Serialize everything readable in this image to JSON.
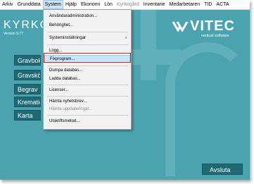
{
  "menubar": {
    "items": [
      {
        "label": "Arkiv",
        "state": "normal"
      },
      {
        "label": "Grunddata",
        "state": "normal"
      },
      {
        "label": "System",
        "state": "active"
      },
      {
        "label": "Hjälp",
        "state": "normal"
      },
      {
        "label": "Ekonomi",
        "state": "normal"
      },
      {
        "label": "Lön",
        "state": "normal"
      },
      {
        "label": "Kyrkogård",
        "state": "disabled"
      },
      {
        "label": "Inventarie",
        "state": "normal"
      },
      {
        "label": "Medarbetaren",
        "state": "normal"
      },
      {
        "label": "TID",
        "state": "normal"
      },
      {
        "label": "ACTA",
        "state": "normal"
      }
    ]
  },
  "app": {
    "title": "KYRKO",
    "version": "Version 9.77"
  },
  "logo": {
    "name": "VITEC",
    "tagline": "vertical software"
  },
  "nav_buttons": [
    {
      "label": "Gravbok"
    },
    {
      "label": "Gravsköt"
    },
    {
      "label": "Begrav"
    },
    {
      "label": "Kremation"
    },
    {
      "label": "Karta"
    }
  ],
  "quit_button": {
    "label": "Avsluta"
  },
  "system_menu": {
    "items": [
      {
        "label": "Användaradministration...",
        "disabled": false
      },
      {
        "label": "Behörighet...",
        "disabled": false
      },
      {
        "label": "Systeminställningar",
        "disabled": false,
        "submenu_arrow": "›"
      },
      {
        "label": "Logg...",
        "disabled": false
      },
      {
        "label": "Fixprogram...",
        "disabled": false,
        "highlighted": true
      },
      {
        "label": "Dumpa databas...",
        "disabled": false
      },
      {
        "label": "Ladda databas...",
        "disabled": false
      },
      {
        "label": "Licenser...",
        "disabled": false
      },
      {
        "label": "Hämta nyhetsbrev...",
        "disabled": false
      },
      {
        "label": "Hämta uppdateringar...",
        "disabled": true
      },
      {
        "label": "Utskriftsmetod...",
        "disabled": false
      }
    ]
  },
  "colors": {
    "background": "#4aa3ae",
    "button": "#1e6973",
    "highlight_frame": "#c62828"
  }
}
